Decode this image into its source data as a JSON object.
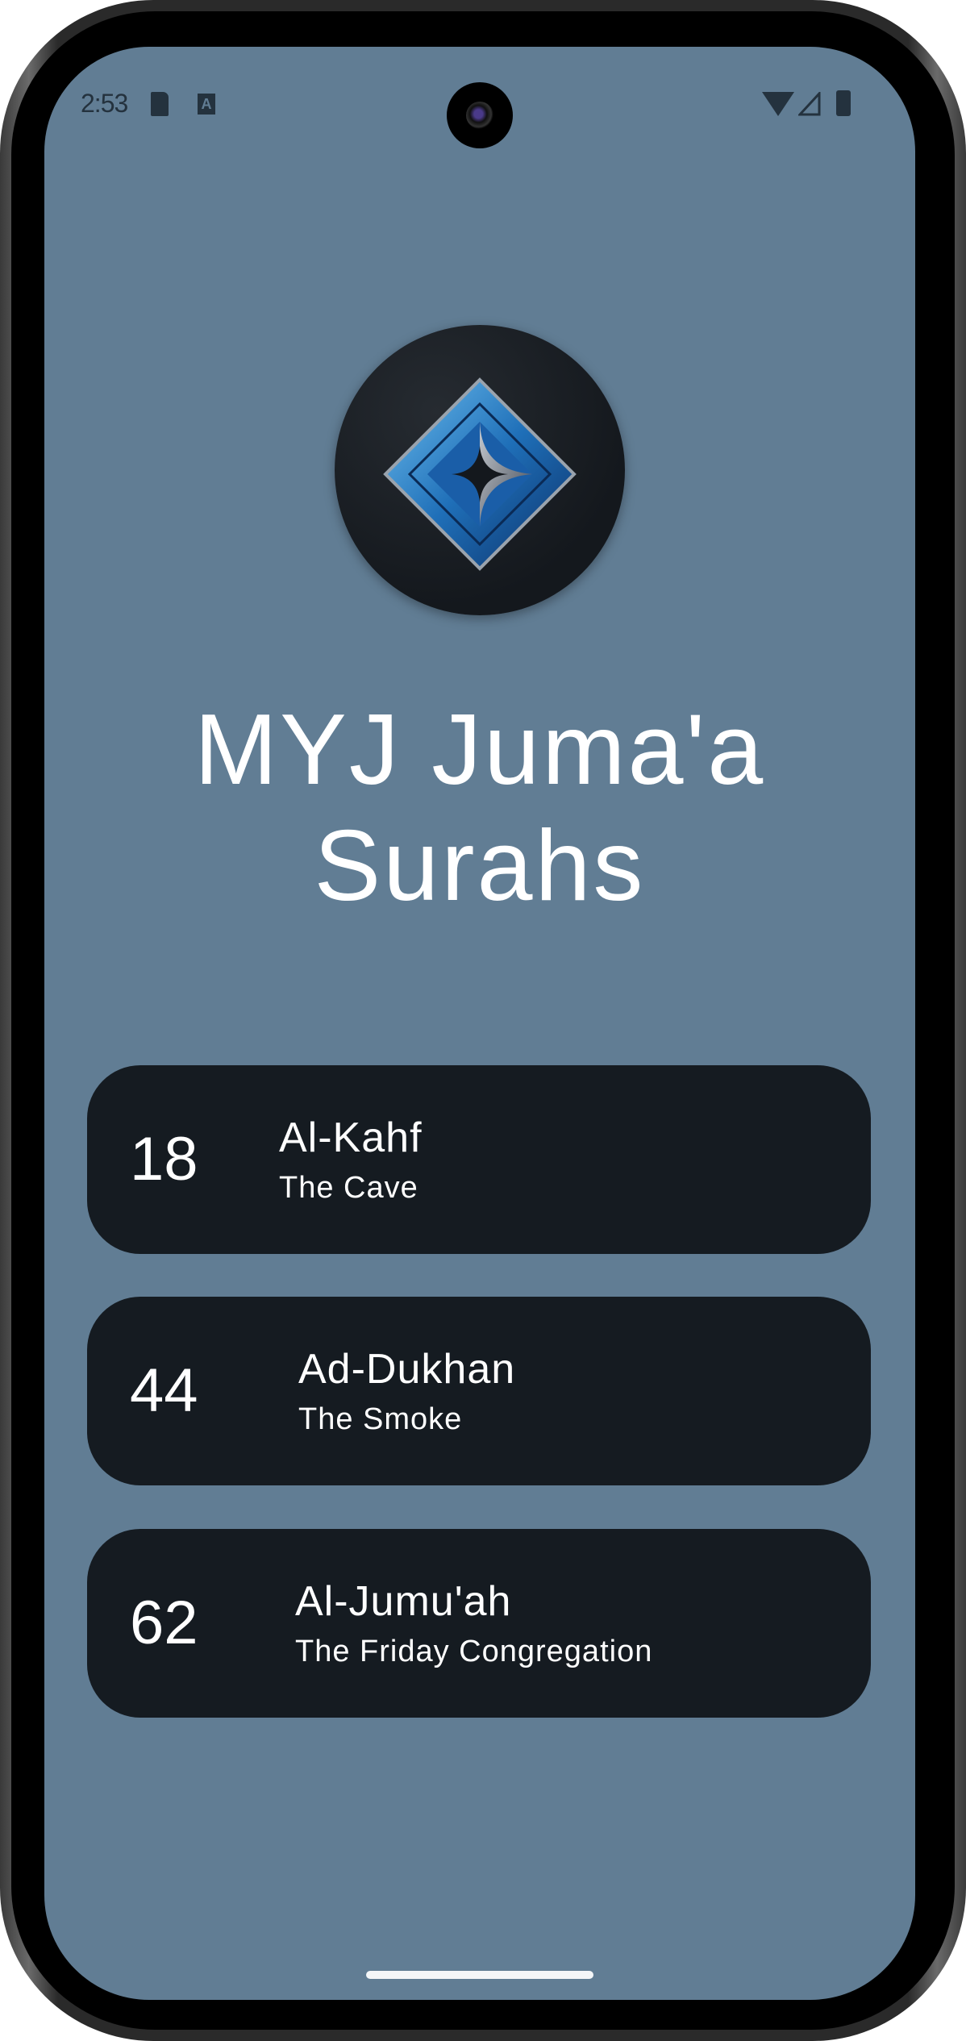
{
  "status_bar": {
    "time": "2:53",
    "icons": [
      "sd-card-icon",
      "autofill-a-icon",
      "wifi-icon",
      "signal-icon",
      "battery-icon"
    ],
    "a_glyph": "A"
  },
  "app": {
    "title": "MYJ Juma'a Surahs",
    "logo": "blue-diamond-logo",
    "background_color": "#617d94",
    "card_color": "#151b21"
  },
  "surahs": [
    {
      "number": "18",
      "name": "Al-Kahf",
      "translation": "The Cave"
    },
    {
      "number": "44",
      "name": "Ad-Dukhan",
      "translation": "The Smoke"
    },
    {
      "number": "62",
      "name": "Al-Jumu'ah",
      "translation": "The Friday Congregation"
    }
  ]
}
